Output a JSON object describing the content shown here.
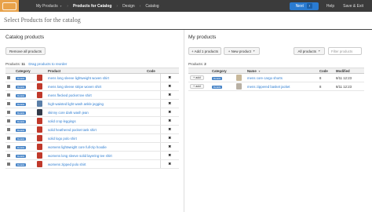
{
  "topbar": {
    "crumbs": [
      "My Products",
      "Products for Catalog",
      "Design",
      "Catalog"
    ],
    "next_label": "Next",
    "help_label": "Help",
    "save_exit_label": "Save & Exit"
  },
  "page_title": "Select Products for the catalog",
  "catalog": {
    "title": "Catalog products",
    "remove_all_label": "Remove all products",
    "count_label": "Products:",
    "count": "11",
    "hint": "Drag products to reorder",
    "columns": [
      "",
      "Category",
      "",
      "Product",
      "Code",
      ""
    ],
    "rows": [
      {
        "tag": "Details",
        "color": "#c0392b",
        "name": "mens long sleeve lightweight woven shirt"
      },
      {
        "tag": "Details",
        "color": "#c0392b",
        "name": "mens long sleeve stripe woven shirt"
      },
      {
        "tag": "Details",
        "color": "#c0392b",
        "name": "mens flecked pocket tee shirt"
      },
      {
        "tag": "Details",
        "color": "#5b7fa8",
        "name": "high-waisted light wash ankle jegging"
      },
      {
        "tag": "Details",
        "color": "#333b4a",
        "name": "skinny core dark wash jean"
      },
      {
        "tag": "Details",
        "color": "#c0392b",
        "name": "solid crop leggings"
      },
      {
        "tag": "Details",
        "color": "#c0392b",
        "name": "solid heathered pocket tank shirt"
      },
      {
        "tag": "Details",
        "color": "#c0392b",
        "name": "solid logo polo shirt"
      },
      {
        "tag": "Details",
        "color": "#c0392b",
        "name": "womens lightweight core full-zip hoodie"
      },
      {
        "tag": "Details",
        "color": "#c0392b",
        "name": "womens long sleeve solid layering tee shirt"
      },
      {
        "tag": "Details",
        "color": "#c0392b",
        "name": "womens zipped polo shirt"
      }
    ],
    "delete_symbol": "✖"
  },
  "my_products": {
    "title": "My products",
    "add_one_label": "+ Add 1 products",
    "new_product_label": "+ New product",
    "all_products_label": "All products",
    "filter_placeholder": "Filter products",
    "count_label": "Products:",
    "count": "2",
    "columns": [
      "",
      "Category",
      "",
      "Name",
      "Code",
      "Modified"
    ],
    "rows": [
      {
        "add_label": "+ add",
        "tag": "Details",
        "color": "#c8b89a",
        "name": "mens core cargo shorts",
        "code": "8",
        "date": "8/11 12:23"
      },
      {
        "add_label": "+ add",
        "tag": "Details",
        "color": "#b8b0a4",
        "name": "mens zippered basket jacket",
        "code": "8",
        "date": "8/11 12:23"
      }
    ]
  }
}
